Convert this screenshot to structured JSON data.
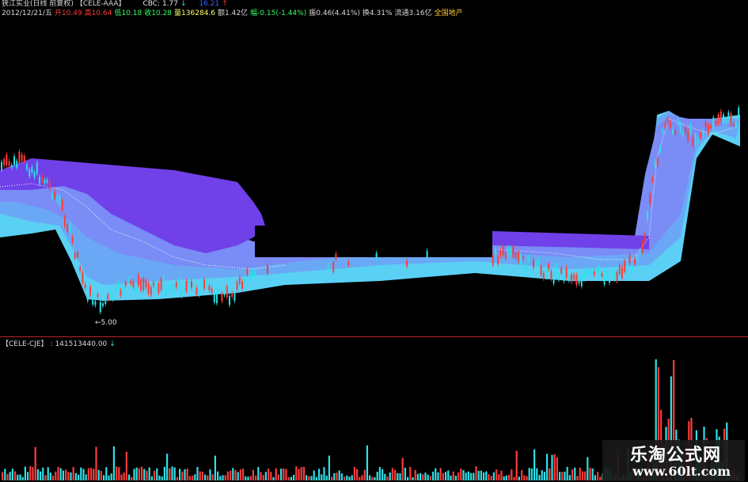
{
  "header": {
    "stock_name": "狭江实业(日线 前复权)",
    "indicator_name": "【CELE-AAA】",
    "cbc_label": "CBC: 1.77",
    "cbc_arrow": "↓",
    "cbc_value2": "16.21",
    "cbc_arrow2": "↑",
    "date": "2012/12/21/五",
    "open_label": "开",
    "open": "10.49",
    "high_label": "高",
    "high": "10.64",
    "low_label": "低",
    "low": "10.18",
    "close_label": "收",
    "close": "10.28",
    "volume_label": "量",
    "volume": "136284.6",
    "amount_label": "额",
    "amount": "1.42亿",
    "change_label": "幅",
    "change": "-0.15(-1.44%)",
    "amplitude_label": "振",
    "amplitude": "0.46(4.41%)",
    "turnover_label": "换",
    "turnover": "4.31%",
    "float_label": "流通",
    "float": "3.16亿",
    "sector": "全国地产"
  },
  "low_marker": "←5.00",
  "lower_panel": {
    "indicator_name": "【CELE-CJE】",
    "value": ": 141513440.00",
    "arrow": "↓"
  },
  "watermark": {
    "title": "乐淘公式网",
    "url": "www.60lt.com"
  },
  "colors": {
    "background": "#000000",
    "up": "#ff3b3b",
    "down": "#2ee0e6",
    "band_dark": "#6a3cf0",
    "band_light": "#5ad0f5"
  }
}
